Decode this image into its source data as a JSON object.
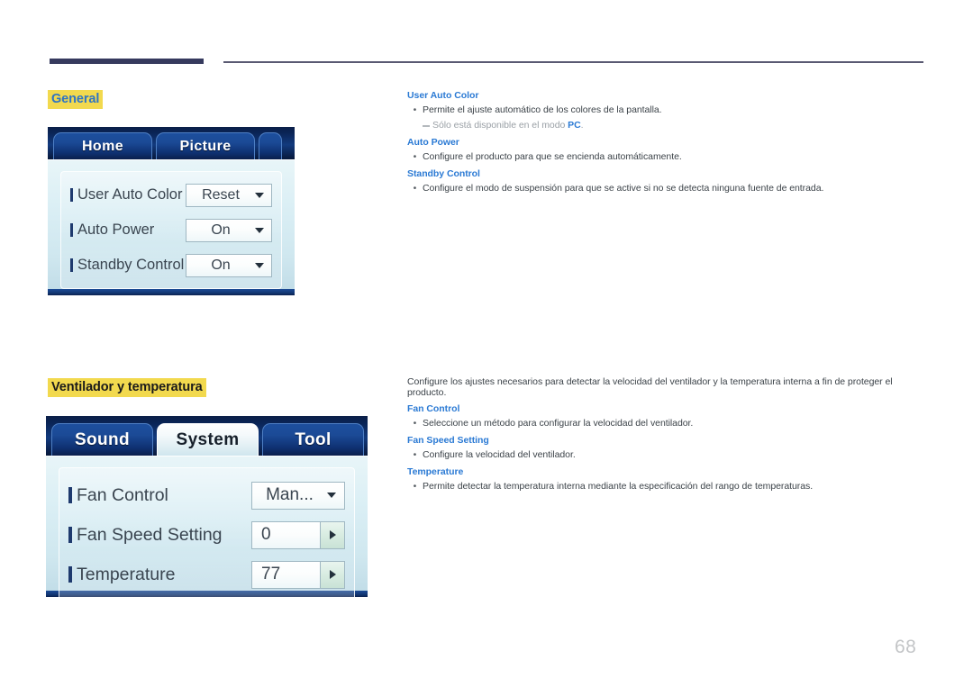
{
  "page": {
    "number": "68",
    "accent_blue": "#2b7ad4",
    "highlight_yellow": "#f2d94e",
    "rule_color": "#363a5e"
  },
  "sections": [
    {
      "heading": "General",
      "osd": {
        "tabs": [
          {
            "label": "Home",
            "active": false
          },
          {
            "label": "Picture",
            "active": false
          }
        ],
        "rows": [
          {
            "label": "User Auto Color",
            "control": "select",
            "value": "Reset"
          },
          {
            "label": "Auto Power",
            "control": "select",
            "value": "On"
          },
          {
            "label": "Standby Control",
            "control": "select",
            "value": "On"
          }
        ]
      },
      "text": {
        "intro": "",
        "entries": [
          {
            "term": "User Auto Color",
            "desc": "Permite el ajuste automático de los colores de la pantalla.",
            "note_prefix": "Sólo está disponible en el modo ",
            "note_bold": "PC",
            "note_suffix": "."
          },
          {
            "term": "Auto Power",
            "desc": "Configure el producto para que se encienda automáticamente."
          },
          {
            "term": "Standby Control",
            "desc": "Configure el modo de suspensión para que se active si no se detecta ninguna fuente de entrada."
          }
        ]
      }
    },
    {
      "heading": "Ventilador y temperatura",
      "osd": {
        "tabs": [
          {
            "label": "Sound",
            "active": false
          },
          {
            "label": "System",
            "active": true
          },
          {
            "label": "Tool",
            "active": false
          }
        ],
        "rows": [
          {
            "label": "Fan Control",
            "control": "select",
            "value": "Man..."
          },
          {
            "label": "Fan Speed Setting",
            "control": "stepper",
            "value": "0"
          },
          {
            "label": "Temperature",
            "control": "stepper",
            "value": "77"
          }
        ]
      },
      "text": {
        "intro": "Configure los ajustes necesarios para detectar la velocidad del ventilador y la temperatura interna a fin de proteger el producto.",
        "entries": [
          {
            "term": "Fan Control",
            "desc": "Seleccione un método para configurar la velocidad del ventilador."
          },
          {
            "term": "Fan Speed Setting",
            "desc": "Configure la velocidad del ventilador."
          },
          {
            "term": "Temperature",
            "desc": "Permite detectar la temperatura interna mediante la especificación del rango de temperaturas."
          }
        ]
      }
    }
  ],
  "bullet_glyph": "•"
}
